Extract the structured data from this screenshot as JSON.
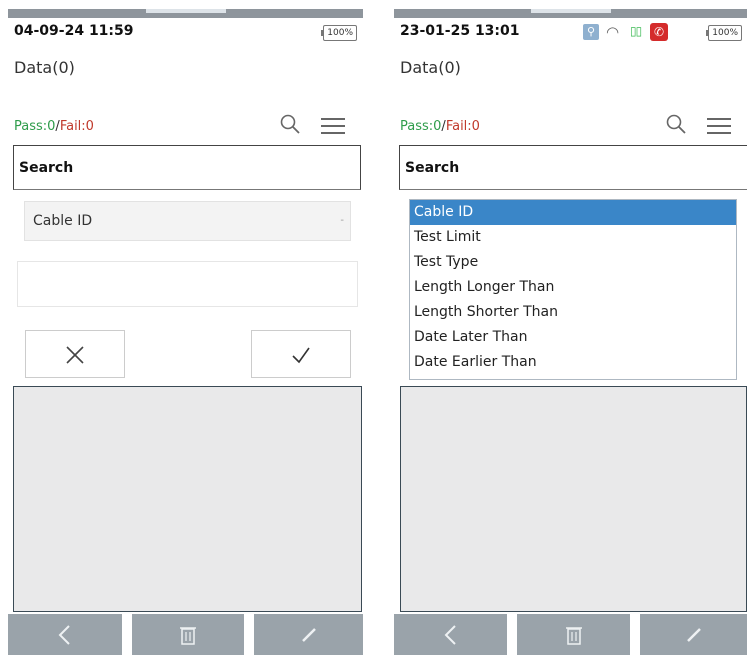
{
  "left": {
    "status": {
      "time": "04-09-24 11:59",
      "battery": "100%"
    },
    "title": "Data(0)",
    "counts": {
      "pass_label": "Pass:0",
      "separator": "/",
      "fail_label": "Fail:0"
    },
    "search": {
      "header": "Search",
      "field_selected": "Cable ID",
      "input_value": "",
      "cancel_icon": "x-icon",
      "confirm_icon": "check-icon"
    }
  },
  "right": {
    "status": {
      "time": "23-01-25 13:01",
      "battery": "100%",
      "icons": [
        "usb-icon",
        "wifi-icon",
        "signal-icon",
        "phone-icon"
      ]
    },
    "title": "Data(0)",
    "counts": {
      "pass_label": "Pass:0",
      "separator": "/",
      "fail_label": "Fail:0"
    },
    "search": {
      "header": "Search",
      "options": [
        "Cable ID",
        "Test Limit",
        "Test Type",
        "Length Longer Than",
        "Length Shorter Than",
        "Date Later Than",
        "Date Earlier Than"
      ],
      "selected": "Cable ID"
    }
  },
  "nav": {
    "icons": [
      "back-icon",
      "delete-icon",
      "edit-icon"
    ]
  },
  "colors": {
    "pass": "#2e9c4a",
    "fail": "#c0392b",
    "selection": "#3a86c8",
    "navbar": "#9aa3aa"
  }
}
